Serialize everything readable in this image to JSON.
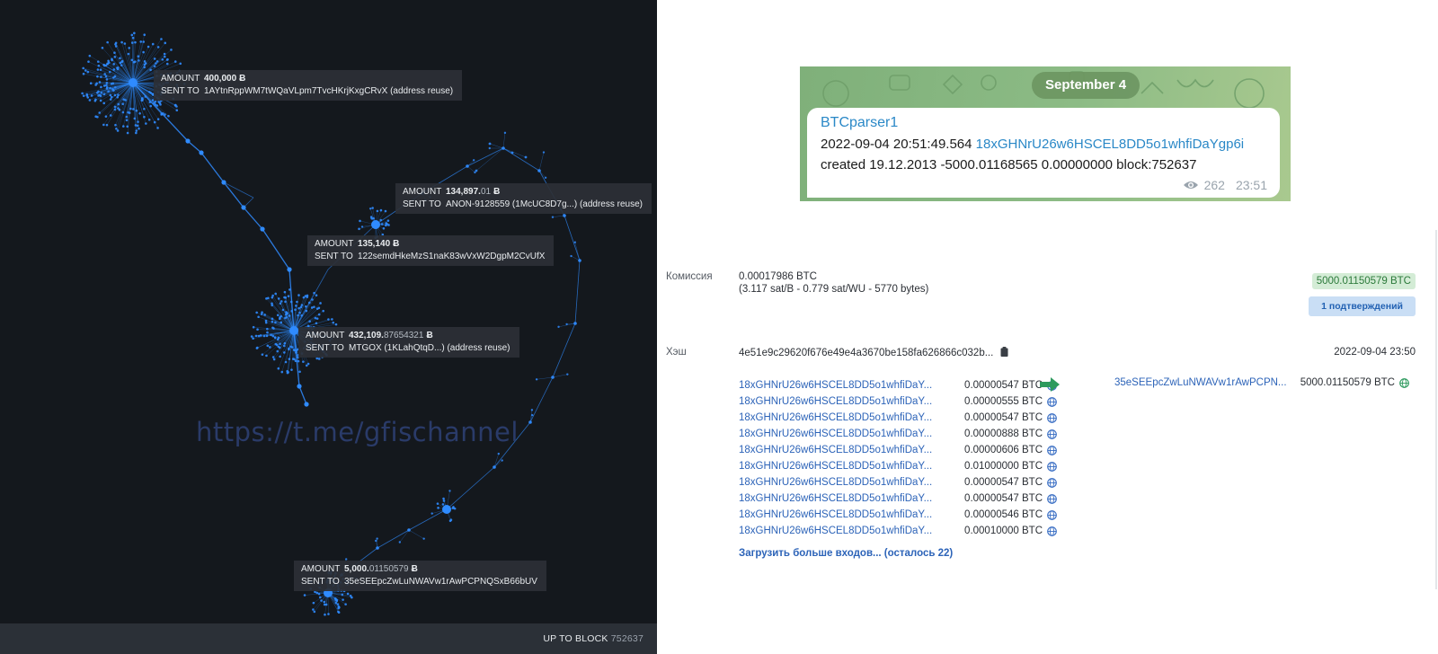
{
  "graph": {
    "tooltips": [
      {
        "amount_main": "400,000",
        "amount_frac": "",
        "symbol": "Ƀ",
        "sent_to": "1AYtnRppWM7tWQaVLpm7TvcHKrjKxgCRvX (address reuse)"
      },
      {
        "amount_main": "134,897.",
        "amount_frac": "01",
        "symbol": "Ƀ",
        "sent_to": "ANON-9128559 (1McUC8D7g...) (address reuse)"
      },
      {
        "amount_main": "135,140",
        "amount_frac": "",
        "symbol": "Ƀ",
        "sent_to": "122semdHkeMzS1naK83wVxW2DgpM2CvUfX"
      },
      {
        "amount_main": "432,109.",
        "amount_frac": "87654321",
        "symbol": "Ƀ",
        "sent_to": "MTGOX (1KLahQtqD...) (address reuse)"
      },
      {
        "amount_main": "5,000.",
        "amount_frac": "01150579",
        "symbol": "Ƀ",
        "sent_to": "35eSEEpcZwLuNWAVw1rAwPCPNQSxB66bUV"
      }
    ],
    "labels": {
      "amount": "AMOUNT",
      "sent_to": "SENT TO"
    },
    "watermark": "https://t.me/gfischannel",
    "block_label": "UP TO BLOCK",
    "block_number": "752637"
  },
  "telegram": {
    "date": "September 4",
    "sender": "BTCparser1",
    "line1_prefix": "2022-09-04 20:51:49.564",
    "line1_address": "18xGHNrU26w6HSCEL8DD5o1whfiDaYgp6i",
    "line2": "created 19.12.2013 -5000.01168565 0.00000000 block:752637",
    "views": "262",
    "time": "23:51"
  },
  "tx": {
    "fee_label": "Комиссия",
    "fee_value": "0.00017986 BTC",
    "fee_detail": "(3.117 sat/B - 0.779 sat/WU - 5770 bytes)",
    "total": "5000.01150579 BTC",
    "confirmations": "1 подтверждений",
    "hash_label": "Хэш",
    "hash_value": "4e51e9c29620f676e49e4a3670be158fa626866c032b...",
    "date": "2022-09-04 23:50",
    "inputs": [
      {
        "address": "18xGHNrU26w6HSCEL8DD5o1whfiDaY...",
        "amount": "0.00000547 BTC"
      },
      {
        "address": "18xGHNrU26w6HSCEL8DD5o1whfiDaY...",
        "amount": "0.00000555 BTC"
      },
      {
        "address": "18xGHNrU26w6HSCEL8DD5o1whfiDaY...",
        "amount": "0.00000547 BTC"
      },
      {
        "address": "18xGHNrU26w6HSCEL8DD5o1whfiDaY...",
        "amount": "0.00000888 BTC"
      },
      {
        "address": "18xGHNrU26w6HSCEL8DD5o1whfiDaY...",
        "amount": "0.00000606 BTC"
      },
      {
        "address": "18xGHNrU26w6HSCEL8DD5o1whfiDaY...",
        "amount": "0.01000000 BTC"
      },
      {
        "address": "18xGHNrU26w6HSCEL8DD5o1whfiDaY...",
        "amount": "0.00000547 BTC"
      },
      {
        "address": "18xGHNrU26w6HSCEL8DD5o1whfiDaY...",
        "amount": "0.00000547 BTC"
      },
      {
        "address": "18xGHNrU26w6HSCEL8DD5o1whfiDaY...",
        "amount": "0.00000546 BTC"
      },
      {
        "address": "18xGHNrU26w6HSCEL8DD5o1whfiDaY...",
        "amount": "0.00010000 BTC"
      }
    ],
    "output": {
      "address": "35eSEEpcZwLuNWAVw1rAwPCPN...",
      "amount": "5000.01150579 BTC"
    },
    "load_more": "Загрузить больше входов... (осталось 22)"
  },
  "icons": {
    "input_globe": "globe-icon",
    "output_globe": "globe-icon",
    "arrow": "arrow-right-icon",
    "clipboard": "clipboard-icon",
    "views": "eye-icon"
  },
  "colors": {
    "graph_bg": "#14181d",
    "graph_node": "#2f8bff",
    "link": "#2c63b8",
    "badge_green": "#d4ecd6",
    "badge_blue": "#c9def5",
    "telegram_bg": "#8cbb85",
    "arrow": "#2e9a5e"
  }
}
